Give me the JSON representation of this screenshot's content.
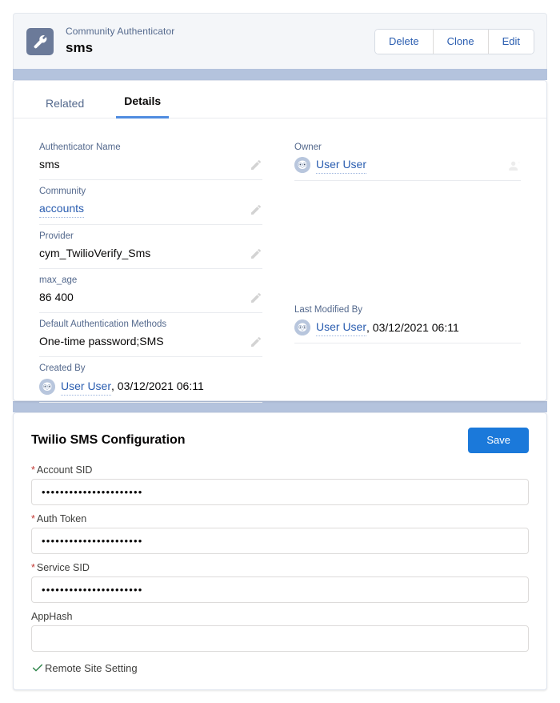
{
  "record_header": {
    "icon": "wrench-icon",
    "eyebrow": "Community Authenticator",
    "title": "sms",
    "actions": [
      {
        "label": "Delete",
        "name": "delete-button"
      },
      {
        "label": "Clone",
        "name": "clone-button"
      },
      {
        "label": "Edit",
        "name": "edit-button"
      }
    ]
  },
  "tabs": [
    {
      "label": "Related",
      "active": false
    },
    {
      "label": "Details",
      "active": true
    }
  ],
  "details": {
    "left": [
      {
        "label": "Authenticator Name",
        "value": "sms",
        "type": "text",
        "editable": true
      },
      {
        "label": "Community",
        "value": "accounts",
        "type": "link",
        "editable": true
      },
      {
        "label": "Provider",
        "value": "cym_TwilioVerify_Sms",
        "type": "text",
        "editable": true
      },
      {
        "label": "max_age",
        "value": "86 400",
        "type": "text",
        "editable": true
      },
      {
        "label": "Default Authentication Methods",
        "value": "One-time password;SMS",
        "type": "text",
        "editable": true
      },
      {
        "label": "Created By",
        "value": "User User",
        "suffix": ", 03/12/2021 06:11",
        "type": "user",
        "editable": false
      }
    ],
    "right": [
      {
        "label": "Owner",
        "value": "User User",
        "type": "user",
        "editable": true
      },
      {
        "label": "Last Modified By",
        "value": "User User",
        "suffix": ", 03/12/2021 06:11",
        "type": "user",
        "editable": false
      }
    ]
  },
  "twilio": {
    "title": "Twilio SMS Configuration",
    "save_label": "Save",
    "fields": [
      {
        "label": "Account SID",
        "required": true,
        "value": "••••••••••••••••••••••",
        "placeholder": ""
      },
      {
        "label": "Auth Token",
        "required": true,
        "value": "••••••••••••••••••••••",
        "placeholder": ""
      },
      {
        "label": "Service SID",
        "required": true,
        "value": "••••••••••••••••••••••",
        "placeholder": ""
      },
      {
        "label": "AppHash",
        "required": false,
        "value": "",
        "placeholder": ""
      }
    ],
    "remote_site_setting": {
      "label": "Remote Site Setting",
      "status_icon": "check-icon",
      "status_color": "#2e844a"
    }
  },
  "colors": {
    "accent": "#1b79da",
    "link": "#2a5db0",
    "required": "#c23934",
    "page_band": "#b4c3dd",
    "icon_bg": "#6b7a99",
    "success": "#2e844a"
  }
}
